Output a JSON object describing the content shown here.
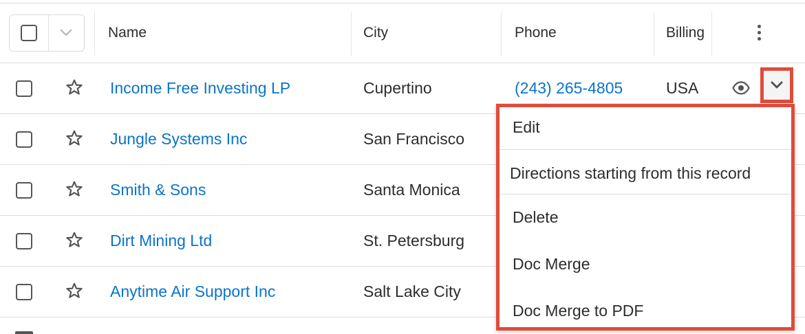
{
  "table": {
    "columns": {
      "name": "Name",
      "city": "City",
      "phone": "Phone",
      "billing": "Billing"
    },
    "rows": [
      {
        "name": "Income Free Investing LP",
        "city": "Cupertino",
        "phone": "(243) 265-4805",
        "billing": "USA"
      },
      {
        "name": "Jungle Systems Inc",
        "city": "San Francisco"
      },
      {
        "name": "Smith & Sons",
        "city": "Santa Monica"
      },
      {
        "name": "Dirt Mining Ltd",
        "city": "St. Petersburg"
      },
      {
        "name": "Anytime Air Support Inc",
        "city": "Salt Lake City"
      }
    ]
  },
  "row_actions": {
    "items": [
      "Edit",
      "Directions starting from this record",
      "Delete",
      "Doc Merge",
      "Doc Merge to PDF"
    ]
  },
  "colors": {
    "link": "#0b74c9",
    "highlight": "#e04b3a",
    "text": "#2b2d2e",
    "border": "#dcdcdc"
  },
  "icons": {
    "mass_select": "checkbox-icon",
    "mass_select_caret": "chevron-down-icon",
    "column_options": "kebab-icon",
    "favorite": "star-icon",
    "preview": "eye-icon",
    "row_actions": "chevron-down-icon"
  }
}
